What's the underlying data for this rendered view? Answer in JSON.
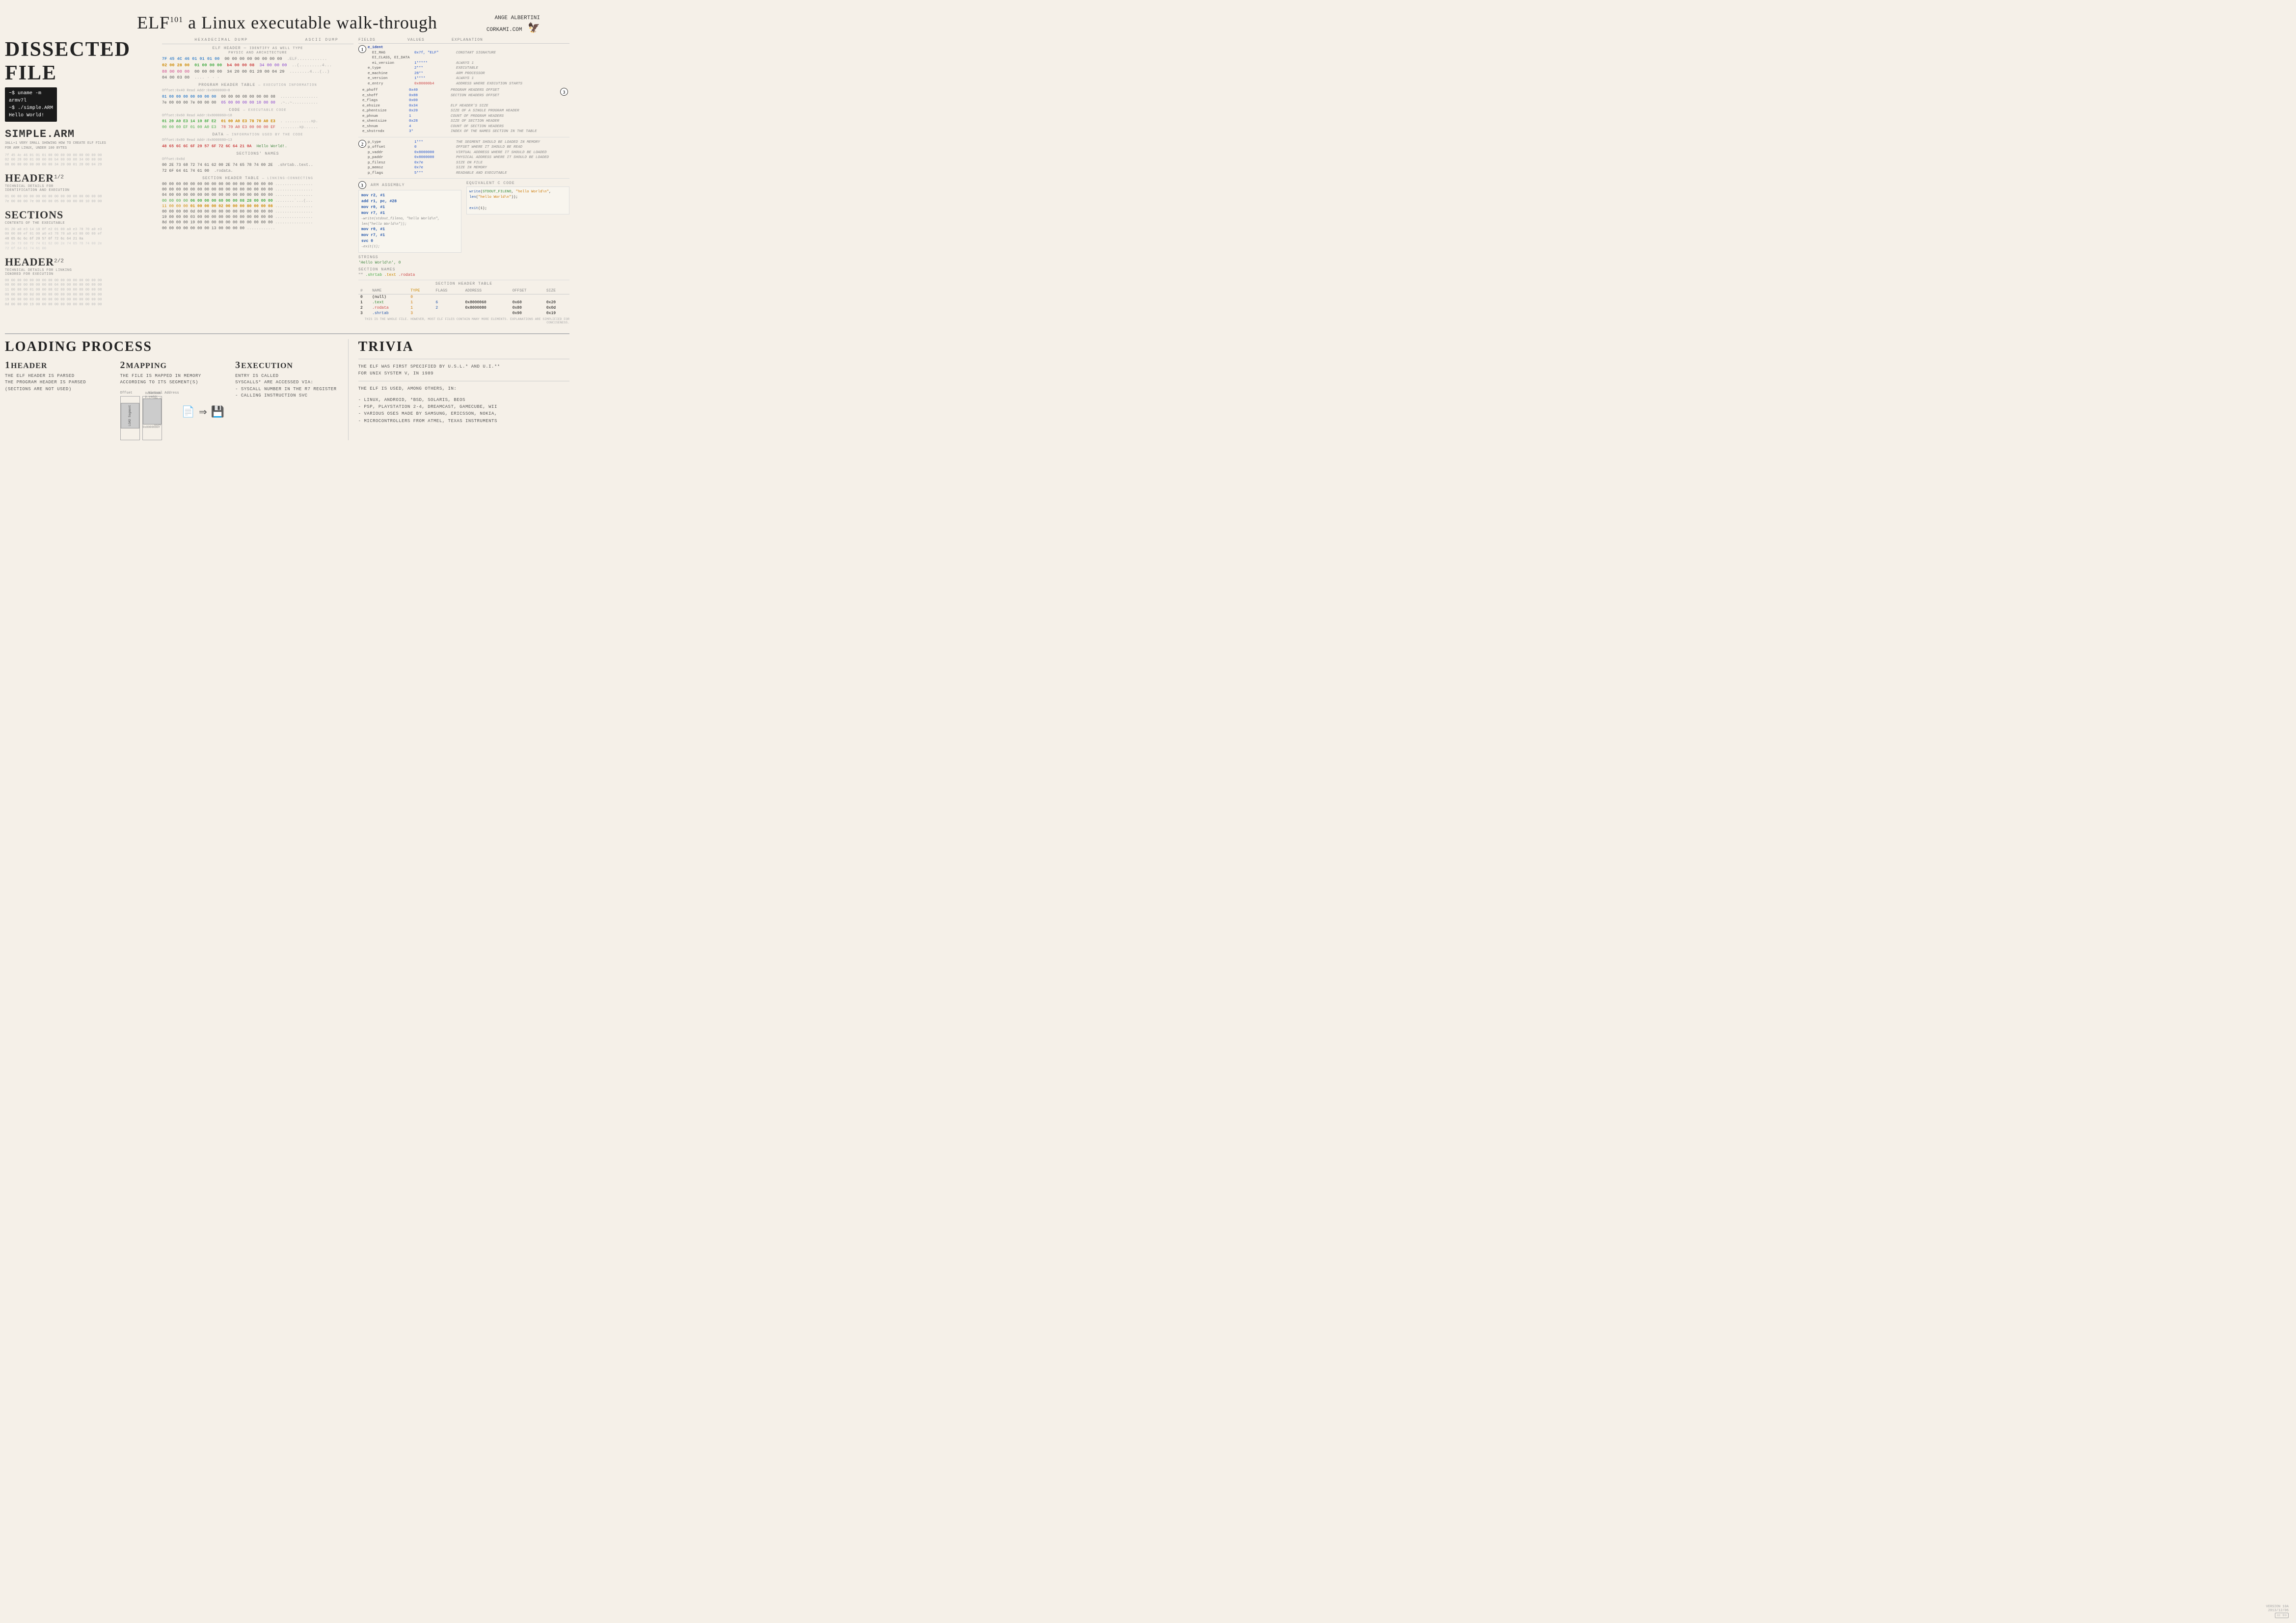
{
  "header": {
    "title": "ELF",
    "title_sup": "101",
    "title_rest": " a Linux executable walk-through",
    "author": "ANGE ALBERTINI\nCORKAMI.COM"
  },
  "dissected": {
    "title": "DISSECTED FILE",
    "terminal": "~$ uname -m\narmv7l\n~$ ./simple.ARM\nHello World!",
    "simple_arm": "SIMPLE.ARM",
    "simple_arm_desc": "3ALL+1 VERY SMALL SHOWING HOW TO CREATE ELF FILES\nFOR ARM LINUX, UNDER 100 BYTES",
    "header1_title": "HEADER",
    "header1_sup": "1/2",
    "header1_desc": "TECHNICAL DETAILS FOR\nIDENTIFICATION AND EXECUTION",
    "sections_title": "SECTIONS",
    "sections_desc": "CONTENTS OF THE EXECUTABLE",
    "header2_title": "HEADER",
    "header2_sup": "2/2",
    "header2_desc": "TECHNICAL DETAILS FOR LINKING\nIGNORED FOR EXECUTION",
    "col_hexdump": "HEXADECIMAL DUMP",
    "col_asciidump": "ASCII DUMP"
  },
  "elf_header_label": "ELF HEADER",
  "elf_header_sublabel": "IDENTIFY AS WELL TYPE\nPHYSIC AND ARCHITECTURE",
  "program_header_label": "PROGRAM HEADER TABLE",
  "program_header_sublabel": "EXECUTION INFORMATION",
  "code_label": "CODE",
  "code_sublabel": "EXECUTABLE CODE",
  "data_label": "DATA",
  "data_sublabel": "INFORMATION USED BY THE CODE",
  "sections_names_label": "SECTIONS' NAMES",
  "section_header_label": "SECTION HEADER TABLE",
  "section_header_sublabel": "LINKING-CONNECTING PROGRAM OBJECTS TO INFORMATION",
  "fields_header": {
    "col1": "FIELDS",
    "col2": "VALUES",
    "col3": "EXPLANATION"
  },
  "elf_ident_fields": [
    {
      "name": "e_ident",
      "value": "",
      "explanation": ""
    },
    {
      "name": "  EI_MAG",
      "value": "0x7f, \"ELF\"",
      "explanation": "CONSTANT SIGNATURE"
    },
    {
      "name": "  EI_CLASS",
      "value": "1 (=====",
      "explanation": "32 BITS, LITTLE-ENDIAN"
    },
    {
      "name": "  EI_DATA",
      "value": "1*****",
      "explanation": "ALWAYS 1"
    },
    {
      "name": "e_type",
      "value": "2***",
      "explanation": "EXECUTABLE"
    },
    {
      "name": "e_machine",
      "value": "28**",
      "explanation": "ARM PROCESSOR"
    },
    {
      "name": "e_version",
      "value": "1****",
      "explanation": "ALWAYS 1"
    },
    {
      "name": "e_entry",
      "value": "0x8000b4",
      "explanation": "ADDRESS WHERE EXECUTION STARTS"
    },
    {
      "name": "e_phoff",
      "value": "0x40",
      "explanation": "PROGRAM HEADERS OFFSET"
    },
    {
      "name": "e_shoff",
      "value": "0x88",
      "explanation": "SECTION HEADERS OFFSET"
    },
    {
      "name": "e_flags",
      "value": "0x00",
      "explanation": ""
    },
    {
      "name": "e_ehsize",
      "value": "0x34",
      "explanation": "ELF HEADER'S SIZE"
    },
    {
      "name": "e_phentsize",
      "value": "0x20",
      "explanation": "SIZE OF A SINGLE PROGRAM HEADER"
    },
    {
      "name": "e_phnum",
      "value": "1",
      "explanation": "COUNT OF PROGRAM HEADERS"
    },
    {
      "name": "e_shentsize",
      "value": "0x28",
      "explanation": "SIZE OF SECTION HEADER"
    },
    {
      "name": "e_shnum",
      "value": "4",
      "explanation": "COUNT OF SECTION HEADERS"
    },
    {
      "name": "e_shstrndx",
      "value": "3*",
      "explanation": "INDEX OF THE NAMES SECTION IN THE TABLE"
    }
  ],
  "segment_fields": [
    {
      "name": "p_type",
      "value": "1***",
      "explanation": "THE SEGMENT SHOULD BE LOADED IN MEMORY"
    },
    {
      "name": "p_offset",
      "value": "0",
      "explanation": "OFFSET WHERE IT SHOULD BE READ"
    },
    {
      "name": "p_vaddr",
      "value": "0x8000000",
      "explanation": "VIRTUAL ADDRESS WHERE IT SHOULD BE LOADED"
    },
    {
      "name": "p_paddr",
      "value": "0x8000000",
      "explanation": "PHYSICAL ADDRESS WHERE IT SHOULD BE LOADED"
    },
    {
      "name": "p_filesz",
      "value": "0x7e",
      "explanation": "SIZE ON FILE"
    },
    {
      "name": "p_memsz",
      "value": "0x7e",
      "explanation": "SIZE IN MEMORY"
    },
    {
      "name": "p_flags",
      "value": "5***",
      "explanation": "READABLE AND EXECUTABLE"
    }
  ],
  "arm_assembly": {
    "title": "ARM ASSEMBLY",
    "lines": [
      "mov r2, #1",
      "add r1, pc, #28",
      "mov r0, #1",
      "mov r7, #1",
      "  *write(stdout_fileno, \"hello World\\n\", len(\"hello World\\n\"));",
      "mov r0, #1",
      "mov r7, #1",
      "svc 0",
      "  *exit(1);"
    ]
  },
  "c_code": {
    "title": "EQUIVALENT C CODE",
    "lines": [
      "*write(STDOUT_FILENO, \"hello World\\n\", len(\"hello World\\n\"));",
      "",
      "*exit(1);"
    ]
  },
  "strings_section": {
    "title": "STRINGS",
    "value": "'Hello World\\n', 0"
  },
  "section_names": {
    "title": "SECTION NAMES",
    "values": ".shrtab .text  .rodata"
  },
  "section_header_table": {
    "title": "SECTION HEADER TABLE",
    "note": "THIS IS THE WHOLE FILE. HOWEVER, MOST ELF FILES CONTAIN MANY MORE ELEMENTS.\nEXPLANATIONS ARE SIMPLIFIED FOR CONCISENESS.",
    "headers": [
      "#",
      "NAME",
      "TYPE",
      "FLAGS",
      "ADDRESS",
      "OFFSET",
      "SIZE"
    ],
    "rows": [
      {
        "num": "0",
        "name": "(null)",
        "type": "0",
        "flags": "",
        "address": "",
        "offset": "",
        "size": ""
      },
      {
        "num": "1",
        "name": ".text",
        "type": "1",
        "flags": "6",
        "address": "0x8000060",
        "offset": "0x60",
        "size": "0x20"
      },
      {
        "num": "2",
        "name": ".rodata",
        "type": "1",
        "flags": "2",
        "address": "0x8000080",
        "offset": "0x80",
        "size": "0x0d"
      },
      {
        "num": "3",
        "name": ".shrtab",
        "type": "3",
        "flags": "",
        "address": "",
        "offset": "0x90",
        "size": "0x19"
      }
    ]
  },
  "loading": {
    "title": "LOADING PROCESS",
    "step1_num": "1",
    "step1_title": "HEADER",
    "step1_desc": "THE ELF HEADER IS PARSED\nTHE PROGRAM HEADER IS PARSED\n(SECTIONS ARE NOT USED)",
    "step2_num": "2",
    "step2_title": "MAPPING",
    "step2_desc": "THE FILE IS MAPPED IN MEMORY\nACCORDING TO ITS SEGMENT(S)",
    "step3_num": "3",
    "step3_title": "EXECUTION",
    "step3_desc_line1": "ENTRY IS CALLED",
    "step3_desc_line2": "SYSCALLS* ARE ACCESSED VIA:",
    "step3_desc_line3": "- SYSCALL NUMBER IN THE R7 REGISTER",
    "step3_desc_line4": "- CALLING INSTRUCTION SVC",
    "memory_labels": {
      "offset": "Offset",
      "virtual_address": "Virtual Address",
      "p_offset_0": "p_off=0",
      "va_value": "0x8000000 p_vaddr",
      "load_segment": "LOAD Segment",
      "p_0x90": "0x90",
      "va_0x8000090": "0x8000090+"
    }
  },
  "trivia": {
    "title": "TRIVIA",
    "text1": "THE ELF WAS FIRST SPECIFIED BY U.S.L.* AND U.I.**\nFOR UNIX SYSTEM V, IN 1989",
    "text2": "THE ELF IS USED, AMONG OTHERS, IN:",
    "items": [
      "- LINUX, ANDROID, *BSD, SOLARIS, BEOS",
      "- PSP, PLAYSTATION 2-4, DREAMCAST, GAMECUBE, WII",
      "- VARIOUS OSES MADE BY SAMSUNG, ERICSSON, NOKIA,",
      "- MICROCONTROLLERS FROM ATMEL, TEXAS INSTRUMENTS"
    ]
  },
  "version": {
    "label": "VERSION 10A",
    "date": "2013/12/06"
  },
  "hex_rows": {
    "elf_header": [
      {
        "addr": "",
        "bytes": "7F 45 4C 46 01 01 01 00  00 00 00 00 00 00 00 00",
        "ascii": ".ELF............"
      },
      {
        "addr": "",
        "bytes": "02 00 28 00 01 00 00 00  b4 00 00 08 34 00 00 00",
        "ascii": "..(.........4..."
      },
      {
        "addr": "",
        "bytes": "88 00 00 00 00 00 00 00  34 20 00 01 28 00 04 29",
        "ascii": "........4 ..(..)"
      },
      {
        "addr": "",
        "bytes": "04 00 03 00",
        "ascii": "...."
      }
    ],
    "program_header": [
      {
        "addr": "Offset:0x40  Read Addr:0x0000000+8",
        "bytes": "01 00 00 00 00 00 00 00  00 00 00 08 00 00 00 08",
        "ascii": "................"
      },
      {
        "addr": "",
        "bytes": "7e 00 00 00 7e 00 00 00  05 00 00 00 00 10 00 00",
        "ascii": ".~..~..........."
      }
    ],
    "code": [
      {
        "addr": "Offset:0x60  Read Addr:0x8000060+18",
        "bytes": "01 20 A0 E3 14 10 8F E2  01 00 A0 E3 78 70 A0 E3",
        "ascii": ". ...........xp."
      },
      {
        "addr": "",
        "bytes": "00 00 00 EF 01 00 A0 E3  78 70 A0 E3 00 00 00 EF",
        "ascii": "........xp......"
      }
    ],
    "data": [
      {
        "addr": "Offset:0x80  Read Addr:0x8000080+13",
        "bytes": "48 65 6C 6C 6F 20 57 6F  72 6C 64 21 0A",
        "ascii": "Hello World!."
      }
    ],
    "section_names_hex": [
      {
        "addr": "Offset:0x8d  Read Addr:0x...",
        "bytes": "00 2E 73 68 72 74 61 62  00 2E 74 65 78 74 00 2E",
        "ascii": "..shrtab..text.."
      },
      {
        "addr": "",
        "bytes": "72 6F 64 61 74 61 00",
        "ascii": ".rodata."
      }
    ],
    "section_header_hex": [
      {
        "bytes": "00 00 00 00 00 00 00 00  00 00 00 00 00 00 00 00",
        "ascii": "................"
      },
      {
        "bytes": "00 00 00 00 00 00 00 00  00 00 00 00 00 00 00 00",
        "ascii": "................"
      },
      {
        "bytes": "04 00 00 00 00 00 00 00  00 00 00 00 00 00 00 00",
        "ascii": "................"
      },
      {
        "bytes": "00 00 00 00 06 00 00 00  60 00 00 08 28 00 00 00",
        "ascii": "........`...(..."
      },
      {
        "bytes": "11 00 00 00 01 00 00 00  02 00 00 00 80 00 00 08",
        "ascii": "................"
      },
      {
        "bytes": "00 00 00 00 0d 00 00 00  00 00 00 00 00 00 00 00",
        "ascii": "................"
      },
      {
        "bytes": "19 00 00 00 03 00 00 00  00 00 00 00 00 00 00 00",
        "ascii": "................"
      },
      {
        "bytes": "8d 00 00 00 19 00 00 00  00 00 00 00 00 00 00 00",
        "ascii": "................"
      },
      {
        "bytes": "00 00 00 00 00 00 00 13  00 00 00 00",
        "ascii": "............"
      }
    ]
  }
}
